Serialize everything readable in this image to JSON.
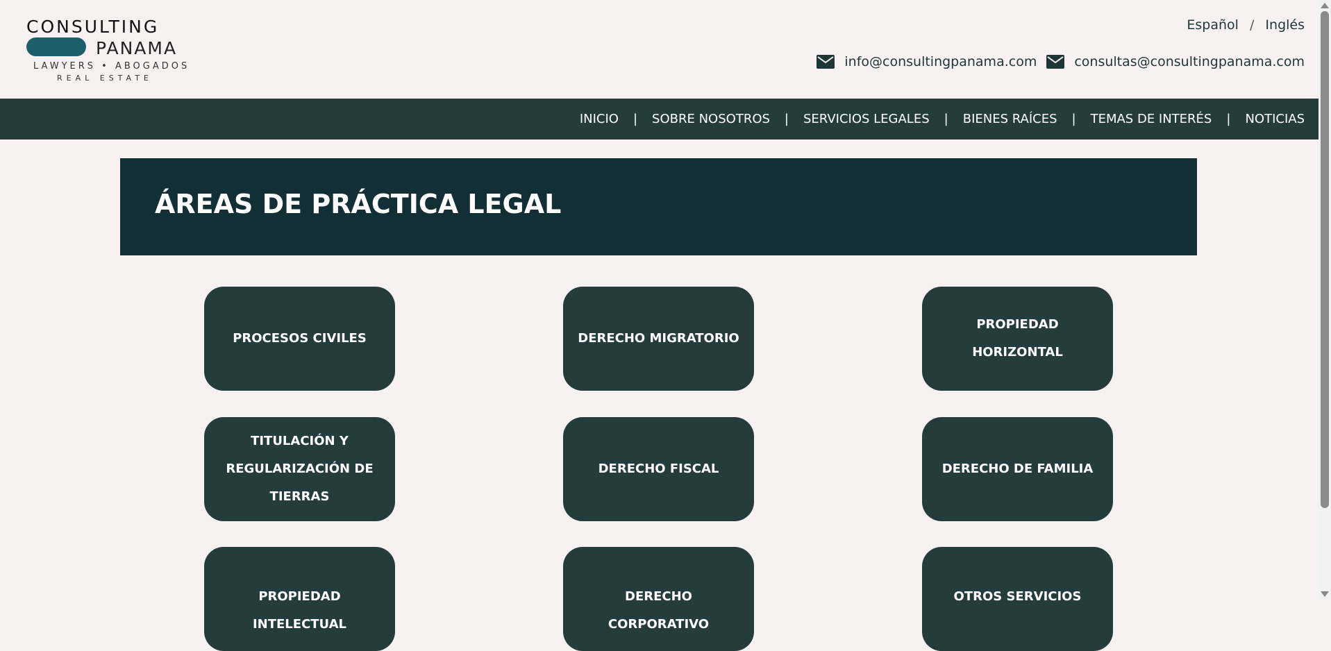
{
  "logo": {
    "line1": "CONSULTING",
    "line2": "PANAMA",
    "line3": "LAWYERS • ABOGADOS",
    "line4": "REAL ESTATE",
    "accent_color": "#1e5f6c"
  },
  "language": {
    "spanish": "Español",
    "separator": "/",
    "english": "Inglés"
  },
  "contacts": [
    {
      "icon": "mail-icon",
      "email": "info@consultingpanama.com"
    },
    {
      "icon": "mail-icon",
      "email": "consultas@consultingpanama.com"
    }
  ],
  "nav": {
    "items": [
      "INICIO",
      "SOBRE NOSOTROS",
      "SERVICIOS LEGALES",
      "BIENES RAÍCES",
      "TEMAS DE INTERÉS",
      "NOTICIAS"
    ],
    "separator": "|",
    "background": "#253c3d"
  },
  "banner": {
    "title": "ÁREAS DE PRÁCTICA LEGAL",
    "background": "#132f36"
  },
  "practice_areas": [
    "PROCESOS CIVILES",
    "DERECHO MIGRATORIO",
    "PROPIEDAD HORIZONTAL",
    "TITULACIÓN Y REGULARIZACIÓN DE TIERRAS",
    "DERECHO FISCAL",
    "DERECHO DE FAMILIA",
    "PROPIEDAD INTELECTUAL",
    "DERECHO CORPORATIVO",
    "OTROS SERVICIOS"
  ],
  "colors": {
    "page_background": "#f7f1f1",
    "card_background": "#253c3d",
    "text_dark": "#1e3638"
  }
}
